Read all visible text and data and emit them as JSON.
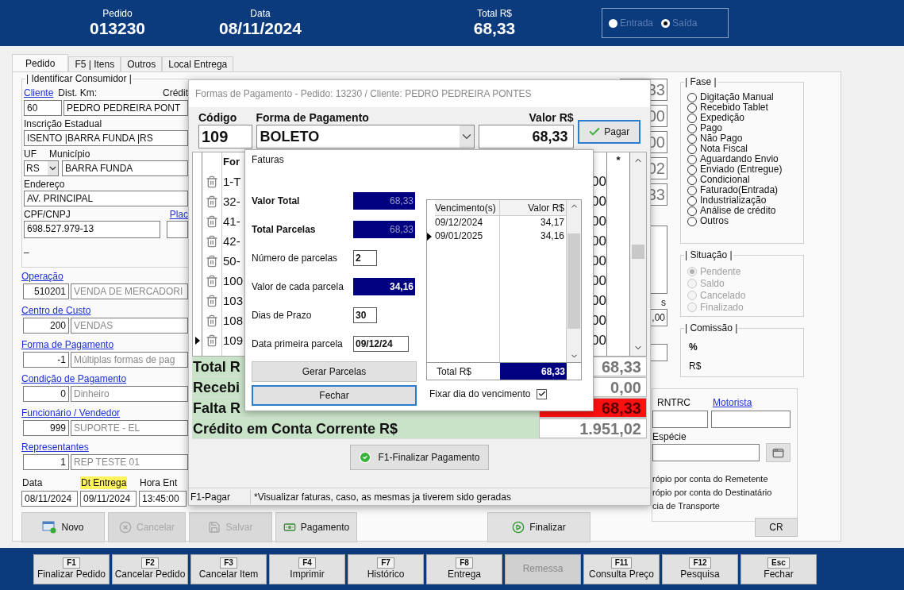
{
  "header": {
    "fields": [
      {
        "label": "Pedido",
        "value": "013230"
      },
      {
        "label": "Data",
        "value": "08/11/2024"
      },
      {
        "label": "Total R$",
        "value": "68,33"
      }
    ],
    "mode_options": [
      {
        "label": "Entrada",
        "selected": false
      },
      {
        "label": "Saída",
        "selected": true
      }
    ]
  },
  "tabs": [
    {
      "label": "Pedido",
      "selected": true
    },
    {
      "label": "F5 | Itens",
      "selected": false
    },
    {
      "label": "Outros",
      "selected": false
    },
    {
      "label": "Local Entrega",
      "selected": false
    }
  ],
  "consumer": {
    "title": "| Identificar Consumidor |",
    "cliente_link": "Cliente",
    "dist_label": "Dist. Km:",
    "credit_label": "Crédit",
    "client_code": "60",
    "client_name": "PEDRO PEDREIRA PONT",
    "ie_label": "Inscrição Estadual",
    "ie_value": "ISENTO  |BARRA FUNDA  |RS",
    "uf_label": "UF",
    "municipio_label": "Município",
    "uf_value": "RS",
    "municipio_value": "BARRA FUNDA",
    "endereco_label": "Endereço",
    "endereco_value": "AV. PRINCIPAL",
    "cpf_label": "CPF/CNPJ",
    "placa_link": "Plac",
    "cpf_value": "698.527.979-13",
    "dash": "–"
  },
  "lookups": [
    {
      "label": "Operação",
      "code": "510201",
      "description": "VENDA DE MERCADORI"
    },
    {
      "label": "Centro de Custo",
      "code": "200",
      "description": "VENDAS"
    },
    {
      "label": "Forma de Pagamento",
      "code": "-1",
      "description": "Múltiplas formas de pag"
    },
    {
      "label": "Condição de Pagamento",
      "code": "0",
      "description": "Dinheiro"
    },
    {
      "label": "Funcionário / Vendedor",
      "code": "999",
      "description": "SUPORTE - EL"
    },
    {
      "label": "Representantes",
      "code": "1",
      "description": "REP TESTE 01"
    }
  ],
  "dates": [
    {
      "label": "Data",
      "value": "08/11/2024",
      "highlight": false
    },
    {
      "label": "Dt Entrega",
      "value": "09/11/2024",
      "highlight": true
    },
    {
      "label": "Hora Ent",
      "value": "13:45:00",
      "highlight": false
    }
  ],
  "peek_values": [
    "33",
    "00",
    "00",
    "02",
    "33"
  ],
  "peek_side": {
    "label": "s",
    "value": ",00"
  },
  "fase": {
    "title": "| Fase |",
    "options": [
      {
        "label": "Digitação Manual",
        "selected": false
      },
      {
        "label": "Recebido Tablet",
        "selected": false
      },
      {
        "label": "Expedição",
        "selected": false
      },
      {
        "label": "Pago",
        "selected": false
      },
      {
        "label": "Não Pago",
        "selected": false
      },
      {
        "label": "Nota Fiscal",
        "selected": false
      },
      {
        "label": "Aguardando Envio",
        "selected": false
      },
      {
        "label": "Enviado (Entregue)",
        "selected": false
      },
      {
        "label": "Condicional",
        "selected": false
      },
      {
        "label": "Faturado(Entrada)",
        "selected": false
      },
      {
        "label": "Industrialização",
        "selected": false
      },
      {
        "label": "Análise de crédito",
        "selected": false
      },
      {
        "label": "Outros",
        "selected": false
      }
    ]
  },
  "situacao": {
    "title": "| Situação |",
    "disabled": true,
    "options": [
      {
        "label": "Pendente",
        "selected": true
      },
      {
        "label": "Saldo",
        "selected": false
      },
      {
        "label": "Cancelado",
        "selected": false
      },
      {
        "label": "Finalizado",
        "selected": false
      }
    ]
  },
  "comissao": {
    "title": "| Comissão |",
    "percent_label": "%",
    "value_label": "R$"
  },
  "transport": {
    "rntrc_label": "RNTRC",
    "motorista_link": "Motorista",
    "especie_label": "Espécie",
    "freight_options": [
      "rópio por conta do Remetente",
      "rópio por conta do Destinatário",
      "cia de Transporte"
    ]
  },
  "new_button": {
    "label": "Novo",
    "disabled": false
  },
  "cancel_button": {
    "label": "Cancelar",
    "disabled": true
  },
  "save_button": {
    "label": "Salvar",
    "disabled": true
  },
  "payment_button": {
    "label": "Pagamento",
    "disabled": false
  },
  "finalize_button": {
    "label": "Finalizar",
    "disabled": false
  },
  "cr_button": "CR",
  "payment_dialog": {
    "title": "Formas de Pagamento - Pedido: 13230 / Cliente: PEDRO PEDREIRA PONTES",
    "codigo_label": "Código",
    "codigo_value": "109",
    "forma_label": "Forma de Pagamento",
    "forma_value": "BOLETO",
    "valor_label": "Valor R$",
    "valor_value": "68,33",
    "pay_button": "Pagar",
    "grid_header": "For",
    "star_header": "*",
    "rows": [
      {
        "forma": "1-T",
        "valor": "00",
        "selected": false
      },
      {
        "forma": "32-",
        "valor": "00",
        "selected": false
      },
      {
        "forma": "41-",
        "valor": "00",
        "selected": false
      },
      {
        "forma": "42-",
        "valor": "00",
        "selected": false
      },
      {
        "forma": "50-",
        "valor": "00",
        "selected": false
      },
      {
        "forma": "100",
        "valor": "00",
        "selected": false
      },
      {
        "forma": "103",
        "valor": "00",
        "selected": false
      },
      {
        "forma": "108",
        "valor": "00",
        "selected": false
      },
      {
        "forma": "109",
        "valor": "00",
        "selected": true
      }
    ],
    "totals": [
      {
        "label": "Total R",
        "value": "68,33",
        "alert": false
      },
      {
        "label": "Recebi",
        "value": "0,00",
        "alert": false
      },
      {
        "label": "Falta R",
        "value": "68,33",
        "alert": true
      },
      {
        "label": "Crédito em Conta Corrente R$",
        "value": "1.951,02",
        "alert": false
      }
    ],
    "finalize_button": "F1-Finalizar Pagamento",
    "status": [
      "F1-Pagar",
      "*Visualizar faturas, caso, as mesmas ja tiverem sido geradas"
    ]
  },
  "faturas": {
    "title": "Faturas",
    "fields": [
      {
        "label": "Valor Total",
        "value": "68,33",
        "kind": "total"
      },
      {
        "label": "Total Parcelas",
        "value": "68,33",
        "kind": "total"
      },
      {
        "label": "Número de parcelas",
        "value": "2",
        "kind": "input"
      },
      {
        "label": "Valor de cada parcela",
        "value": "34,16",
        "kind": "highlight"
      },
      {
        "label": "Dias de Prazo",
        "value": "30",
        "kind": "input"
      },
      {
        "label": "Data primeira parcela",
        "value": "09/12/24",
        "kind": "input"
      }
    ],
    "columns": [
      "Vencimento(s)",
      "Valor R$"
    ],
    "rows": [
      {
        "due": "09/12/2024",
        "value": "34,17",
        "selected": false
      },
      {
        "due": "09/01/2025",
        "value": "34,16",
        "selected": true
      }
    ],
    "total_label": "Total R$",
    "total_value": "68,33",
    "generate_button": "Gerar Parcelas",
    "close_button": "Fechar",
    "fix_day": {
      "label": "Fixar dia do vencimento",
      "checked": true
    }
  },
  "function_keys": [
    {
      "key": "F1",
      "label": "Finalizar Pedido",
      "disabled": false
    },
    {
      "key": "F2",
      "label": "Cancelar Pedido",
      "disabled": false
    },
    {
      "key": "F3",
      "label": "Cancelar Item",
      "disabled": false
    },
    {
      "key": "F4",
      "label": "Imprimir",
      "disabled": false
    },
    {
      "key": "F7",
      "label": "Histórico",
      "disabled": false
    },
    {
      "key": "F8",
      "label": "Entrega",
      "disabled": false
    },
    {
      "label": "Remessa",
      "disabled": true
    },
    {
      "key": "F11",
      "label": "Consulta Preço",
      "disabled": false
    },
    {
      "key": "F12",
      "label": "Pesquisa",
      "disabled": false
    },
    {
      "key": "Esc",
      "label": "Fechar",
      "disabled": false
    }
  ]
}
